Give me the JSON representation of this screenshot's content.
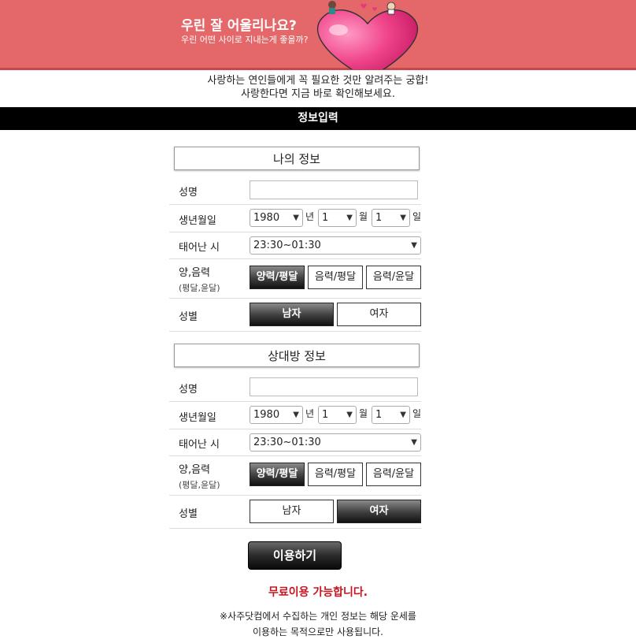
{
  "banner": {
    "title": "우린 잘 어울리나요?",
    "subtitle": "우린 어떤 사이로 지내는게 좋을까?"
  },
  "intro": {
    "line1": "사랑하는 연인들에게 꼭 필요한 것만 알려주는 궁합!",
    "line2": "사랑한다면 지금 바로 확인해보세요."
  },
  "section_title": "정보입력",
  "units": {
    "year": "년",
    "month": "월",
    "day": "일"
  },
  "labels": {
    "name": "성명",
    "birth": "생년월일",
    "birth_time": "태어난 시",
    "calendar": "양,음력",
    "calendar_sub": "(평달,윤달)",
    "gender": "성별"
  },
  "calendar_options": [
    "양력/평달",
    "음력/평달",
    "음력/윤달"
  ],
  "gender_options": [
    "남자",
    "여자"
  ],
  "me": {
    "header": "나의 정보",
    "name_value": "",
    "year": "1980",
    "month": "1",
    "day": "1",
    "time": "23:30~01:30",
    "calendar_selected": "양력/평달",
    "gender_selected": "남자"
  },
  "partner": {
    "header": "상대방 정보",
    "name_value": "",
    "year": "1980",
    "month": "1",
    "day": "1",
    "time": "23:30~01:30",
    "calendar_selected": "양력/평달",
    "gender_selected": "여자"
  },
  "submit_label": "이용하기",
  "free_notice": "무료이용 가능합니다.",
  "privacy": {
    "line1": "※사주닷컴에서 수집하는 개인 정보는 해당 운세를",
    "line2": "이용하는 목적으로만 사용됩니다."
  },
  "colors": {
    "banner": "#e4676a",
    "accent_red": "#c8141e",
    "heart": "#e8457f"
  }
}
